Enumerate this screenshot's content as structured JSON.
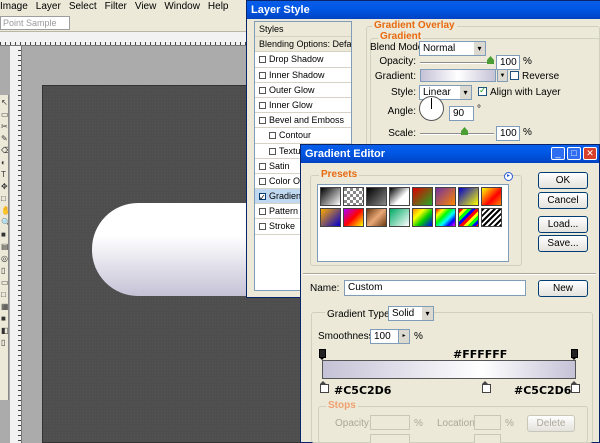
{
  "photoshop": {
    "menu": [
      "Image",
      "Layer",
      "Select",
      "Filter",
      "View",
      "Window",
      "Help"
    ],
    "sample_field": "Point Sample",
    "tool_glyphs": [
      "↖",
      "▭",
      "✂",
      "✎",
      "⌫",
      "◐",
      "T",
      "✥",
      "□",
      "✋",
      "🔍",
      "■",
      "▤",
      "◎",
      "▯",
      "▭",
      "□",
      "▦",
      "■",
      "◧",
      "▯"
    ]
  },
  "layer_style": {
    "title": "Layer Style",
    "list": [
      {
        "label": "Styles",
        "type": "header"
      },
      {
        "label": "Blending Options: Default",
        "type": "header"
      },
      {
        "label": "Drop Shadow",
        "type": "item",
        "checked": false
      },
      {
        "label": "Inner Shadow",
        "type": "item",
        "checked": false
      },
      {
        "label": "Outer Glow",
        "type": "item",
        "checked": false
      },
      {
        "label": "Inner Glow",
        "type": "item",
        "checked": false
      },
      {
        "label": "Bevel and Emboss",
        "type": "item",
        "checked": false
      },
      {
        "label": "Contour",
        "type": "sub",
        "checked": false
      },
      {
        "label": "Texture",
        "type": "sub",
        "checked": false
      },
      {
        "label": "Satin",
        "type": "item",
        "checked": false
      },
      {
        "label": "Color Overlay",
        "type": "item",
        "checked": false
      },
      {
        "label": "Gradient Overlay",
        "type": "item",
        "checked": true,
        "selected": true
      },
      {
        "label": "Pattern Overlay",
        "type": "item",
        "checked": false
      },
      {
        "label": "Stroke",
        "type": "item",
        "checked": false
      }
    ],
    "group_title": "Gradient Overlay",
    "sub_group_title": "Gradient",
    "blend_mode_label": "Blend Mode:",
    "blend_mode_value": "Normal",
    "opacity_label": "Opacity:",
    "opacity_value": "100",
    "opacity_unit": "%",
    "gradient_label": "Gradient:",
    "reverse_label": "Reverse",
    "reverse_checked": false,
    "style_label": "Style:",
    "style_value": "Linear",
    "align_label": "Align with Layer",
    "align_checked": true,
    "angle_label": "Angle:",
    "angle_value": "90",
    "angle_unit": "°",
    "scale_label": "Scale:",
    "scale_value": "100",
    "scale_unit": "%"
  },
  "gradient_editor": {
    "title": "Gradient Editor",
    "presets_label": "Presets",
    "ok_label": "OK",
    "cancel_label": "Cancel",
    "load_label": "Load...",
    "save_label": "Save...",
    "name_label": "Name:",
    "name_value": "Custom",
    "new_label": "New",
    "gradient_type_label": "Gradient Type:",
    "gradient_type_value": "Solid",
    "smoothness_label": "Smoothness:",
    "smoothness_value": "100",
    "smoothness_unit": "%",
    "annotation_mid": "#FFFFFF",
    "annotation_left": "#C5C2D6",
    "annotation_right": "#C5C2D6",
    "stops_title": "Stops",
    "stop_opacity_label": "Opacity:",
    "stop_opacity_unit": "%",
    "location_label": "Location:",
    "location_unit": "%",
    "delete_label": "Delete",
    "colors": {
      "start": "#C5C2D6",
      "mid": "#FFFFFF",
      "end": "#C5C2D6"
    },
    "presets": [
      "linear-gradient(135deg,#000,#fff)",
      "repeating-conic-gradient(#fff 0 25%,#888 0 50%) 0 0/6px 6px",
      "linear-gradient(135deg,#000,#888)",
      "linear-gradient(135deg,#000,#fff 60%,#fff)",
      "linear-gradient(135deg,#d00,#2a2)",
      "linear-gradient(135deg,#7030a0,#f80)",
      "linear-gradient(135deg,#00c,#ff0)",
      "linear-gradient(135deg,#ff0,#f00 60%,#f80)",
      "linear-gradient(135deg,#fa0,#00c)",
      "linear-gradient(135deg,#a0f,#f00 50%,#ff0)",
      "linear-gradient(135deg,#6a3a12,#e9a775 50%,#6a3a12)",
      "linear-gradient(135deg,#0a6,#fff)",
      "linear-gradient(135deg,#f80,#ff0 30%,#0c0 60%,#00f)",
      "linear-gradient(135deg,#f00,#ff0,#0f0,#0ff,#00f,#f0f)",
      "repeating-linear-gradient(135deg,#f00 0 3px,#ff0 3px 6px,#0f0 6px 9px,#00f 9px 12px)",
      "repeating-linear-gradient(135deg,#000 0 2px,#fff 2px 4px)"
    ]
  }
}
